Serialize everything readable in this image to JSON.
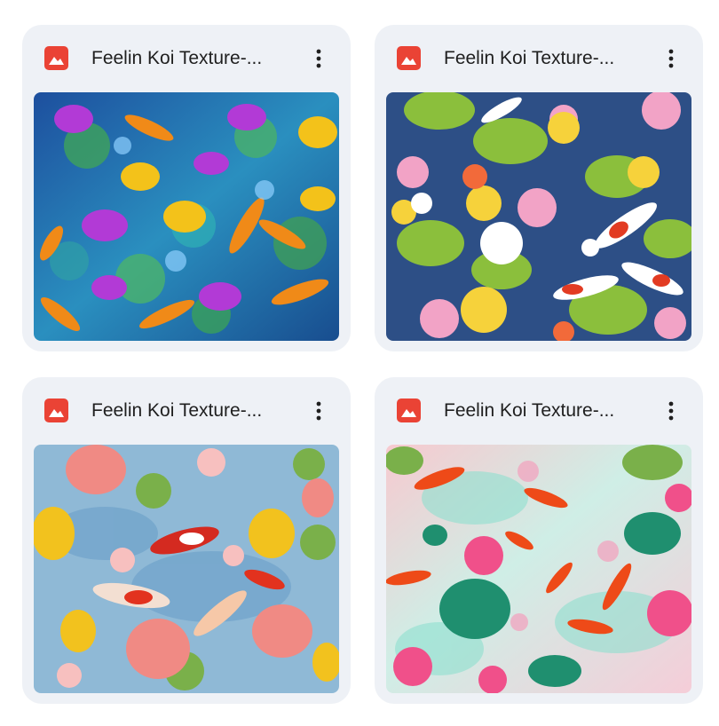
{
  "files": [
    {
      "title": "Feelin Koi Texture-...",
      "icon": "image-file-icon",
      "menu_icon": "more-vert-icon",
      "thumbnail": "koi pond with purple and yellow lotus on blue water"
    },
    {
      "title": "Feelin Koi Texture-...",
      "icon": "image-file-icon",
      "menu_icon": "more-vert-icon",
      "thumbnail": "red and white koi among pink and yellow water lilies"
    },
    {
      "title": "Feelin Koi Texture-...",
      "icon": "image-file-icon",
      "menu_icon": "more-vert-icon",
      "thumbnail": "painted tulips and koi on light blue water"
    },
    {
      "title": "Feelin Koi Texture-...",
      "icon": "image-file-icon",
      "menu_icon": "more-vert-icon",
      "thumbnail": "pastel watercolor koi with teal lily pads and pink lotus"
    }
  ],
  "colors": {
    "card_bg": "#eef1f6",
    "icon_red": "#ea4335",
    "title_text": "#1f1f1f"
  }
}
